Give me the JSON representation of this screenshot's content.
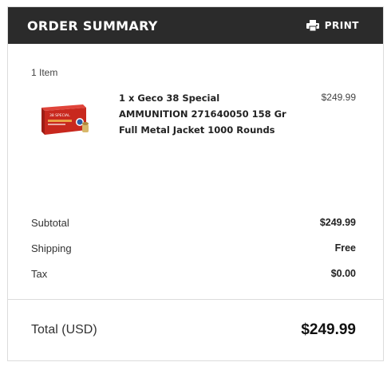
{
  "header": {
    "title": "ORDER SUMMARY",
    "print_label": "PRINT",
    "print_icon": "printer-icon"
  },
  "cart": {
    "item_count": "1 Item",
    "items": [
      {
        "description": "1 x Geco 38 Special AMMUNITION 271640050 158 Gr Full Metal Jacket 1000 Rounds",
        "price": "$249.99",
        "thumbnail_icon": "ammo-box-image"
      }
    ]
  },
  "totals": {
    "subtotal_label": "Subtotal",
    "subtotal_value": "$249.99",
    "shipping_label": "Shipping",
    "shipping_value": "Free",
    "tax_label": "Tax",
    "tax_value": "$0.00"
  },
  "grand_total": {
    "label": "Total (USD)",
    "value": "$249.99"
  },
  "colors": {
    "header_bg": "#2b2b2b",
    "box_red": "#c8281e"
  }
}
